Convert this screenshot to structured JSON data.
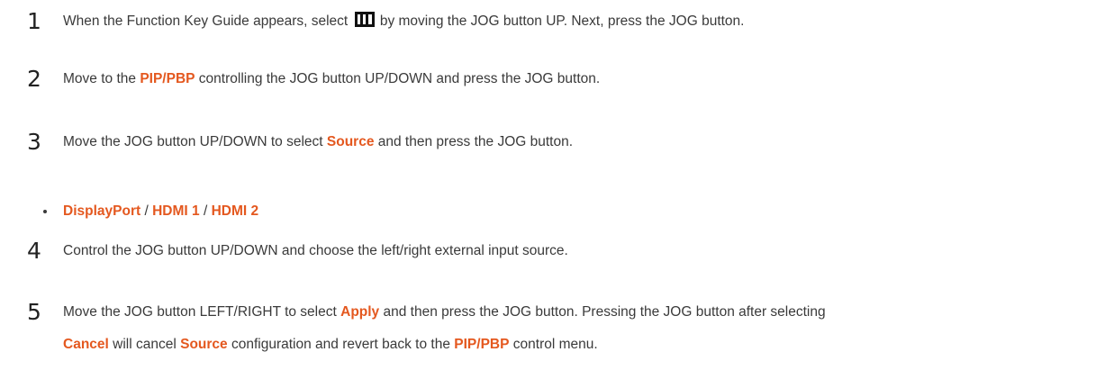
{
  "steps": [
    {
      "number": "1",
      "text_a": "When the Function Key Guide appears, select",
      "icon": "menu-icon",
      "text_b": "by moving the JOG button UP. Next, press the JOG button."
    },
    {
      "number": "2",
      "text_a": "Move to the",
      "kw_1": "PIP/PBP",
      "text_b": "controlling the JOG button UP/DOWN and press the JOG button."
    },
    {
      "number": "3",
      "text_a": "Move the JOG button UP/DOWN to select",
      "kw_1": "Source",
      "text_b": "and then press the JOG button."
    },
    {
      "number": "4",
      "text_a": "Control the JOG button UP/DOWN and choose the left/right external input source."
    },
    {
      "number": "5",
      "line1_a": "Move the JOG button LEFT/RIGHT to select",
      "line1_kw": "Apply",
      "line1_b": "and then press the JOG button. Pressing the JOG button after selecting",
      "line2_kw1": "Cancel",
      "line2_a": "will cancel",
      "line2_kw2": "Source",
      "line2_b": "configuration and revert back to the",
      "line2_kw3": "PIP/PBP",
      "line2_c": "control menu."
    }
  ],
  "sources": {
    "items": [
      "DisplayPort",
      "HDMI 1",
      "HDMI 2"
    ],
    "separator": "/"
  },
  "colors": {
    "keyword": "#e4581f",
    "body_text": "#3a3a3a",
    "number": "#222222"
  }
}
